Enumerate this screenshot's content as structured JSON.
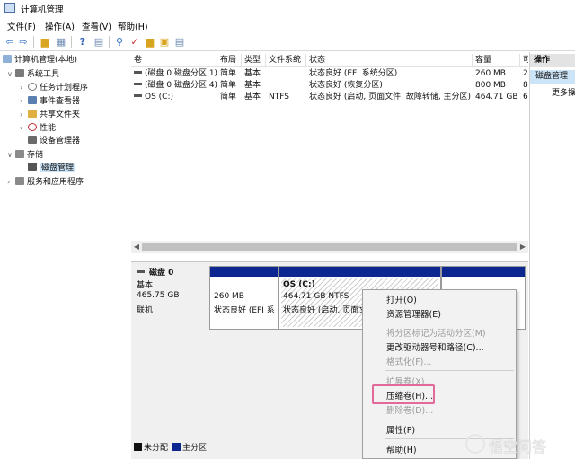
{
  "window": {
    "title": "计算机管理"
  },
  "menu": [
    "文件(F)",
    "操作(A)",
    "查看(V)",
    "帮助(H)"
  ],
  "tree": {
    "root": "计算机管理(本地)",
    "system_tools": "系统工具",
    "task_scheduler": "任务计划程序",
    "event_viewer": "事件查看器",
    "shared_folders": "共享文件夹",
    "performance": "性能",
    "device_manager": "设备管理器",
    "storage": "存储",
    "disk_management": "磁盘管理",
    "services_apps": "服务和应用程序"
  },
  "volumes": {
    "columns": [
      "卷",
      "布局",
      "类型",
      "文件系统",
      "状态",
      "容量",
      "可"
    ],
    "rows": [
      [
        "(磁盘 0 磁盘分区 1)",
        "简单",
        "基本",
        "",
        "状态良好 (EFI 系统分区)",
        "260 MB",
        "2"
      ],
      [
        "(磁盘 0 磁盘分区 4)",
        "简单",
        "基本",
        "",
        "状态良好 (恢复分区)",
        "800 MB",
        "8"
      ],
      [
        "OS (C:)",
        "简单",
        "基本",
        "NTFS",
        "状态良好 (启动, 页面文件, 故障转储, 主分区)",
        "464.71 GB",
        "6"
      ]
    ]
  },
  "disk": {
    "name": "磁盘 0",
    "type": "基本",
    "size": "465.75 GB",
    "status": "联机",
    "part1_size": "260 MB",
    "part1_status": "状态良好 (EFI 系",
    "os_name": "OS  (C:)",
    "os_size": "464.71 GB NTFS",
    "os_status": "状态良好 (启动, 页面文"
  },
  "legend": {
    "unallocated": "未分配",
    "primary": "主分区"
  },
  "actions": {
    "header": "操作",
    "selected": "磁盘管理",
    "more": "更多操"
  },
  "context_menu": {
    "open": "打开(O)",
    "explorer": "资源管理器(E)",
    "mark_active": "将分区标记为活动分区(M)",
    "change_letter": "更改驱动器号和路径(C)...",
    "format": "格式化(F)...",
    "extend": "扩展卷(X)...",
    "shrink": "压缩卷(H)...",
    "delete": "删除卷(D)...",
    "properties": "属性(P)",
    "help": "帮助(H)"
  },
  "watermark": "悟空问答",
  "colors": {
    "primary_partition": "#0c2790",
    "highlight_border": "#e26a9a",
    "selection": "#cce4f7"
  }
}
